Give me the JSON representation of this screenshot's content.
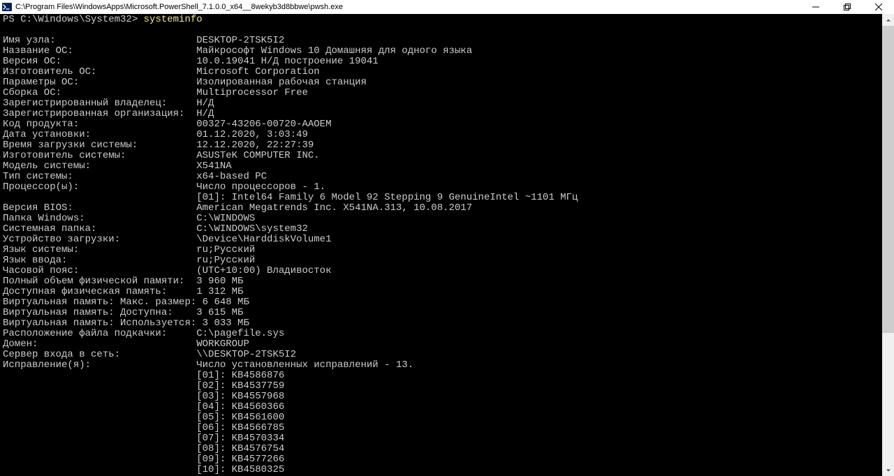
{
  "window": {
    "title": "C:\\Program Files\\WindowsApps\\Microsoft.PowerShell_7.1.0.0_x64__8wekyb3d8bbwe\\pwsh.exe"
  },
  "prompt": {
    "prefix": "PS C:\\Windows\\System32> ",
    "command": "systeminfo"
  },
  "label_width": 33,
  "rows": [
    {
      "label": "Имя узла:",
      "value": "DESKTOP-2TSK5I2"
    },
    {
      "label": "Название ОС:",
      "value": "Майкрософт Windows 10 Домашняя для одного языка"
    },
    {
      "label": "Версия ОС:",
      "value": "10.0.19041 Н/Д построение 19041"
    },
    {
      "label": "Изготовитель ОС:",
      "value": "Microsoft Corporation"
    },
    {
      "label": "Параметры ОС:",
      "value": "Изолированная рабочая станция"
    },
    {
      "label": "Сборка ОС:",
      "value": "Multiprocessor Free"
    },
    {
      "label": "Зарегистрированный владелец:",
      "value": "Н/Д"
    },
    {
      "label": "Зарегистрированная организация:",
      "value": "Н/Д"
    },
    {
      "label": "Код продукта:",
      "value": "00327-43206-00720-AAOEM"
    },
    {
      "label": "Дата установки:",
      "value": "01.12.2020, 3:03:49"
    },
    {
      "label": "Время загрузки системы:",
      "value": "12.12.2020, 22:27:39"
    },
    {
      "label": "Изготовитель системы:",
      "value": "ASUSTeK COMPUTER INC."
    },
    {
      "label": "Модель системы:",
      "value": "X541NA"
    },
    {
      "label": "Тип системы:",
      "value": "x64-based PC"
    },
    {
      "label": "Процессор(ы):",
      "value": "Число процессоров - 1."
    },
    {
      "label": "",
      "value": "[01]: Intel64 Family 6 Model 92 Stepping 9 GenuineIntel ~1101 МГц"
    },
    {
      "label": "Версия BIOS:",
      "value": "American Megatrends Inc. X541NA.313, 10.08.2017"
    },
    {
      "label": "Папка Windows:",
      "value": "C:\\WINDOWS"
    },
    {
      "label": "Системная папка:",
      "value": "C:\\WINDOWS\\system32"
    },
    {
      "label": "Устройство загрузки:",
      "value": "\\Device\\HarddiskVolume1"
    },
    {
      "label": "Язык системы:",
      "value": "ru;Русский"
    },
    {
      "label": "Язык ввода:",
      "value": "ru;Русский"
    },
    {
      "label": "Часовой пояс:",
      "value": "(UTC+10:00) Владивосток"
    },
    {
      "label": "Полный объем физической памяти:",
      "value": "3 960 МБ"
    },
    {
      "label": "Доступная физическая память:",
      "value": "1 312 МБ"
    },
    {
      "label": "Виртуальная память: Макс. размер:",
      "value": "6 648 МБ",
      "tight": true
    },
    {
      "label": "Виртуальная память: Доступна:",
      "value": "3 615 МБ"
    },
    {
      "label": "Виртуальная память: Используется:",
      "value": "3 033 МБ",
      "tight": true
    },
    {
      "label": "Расположение файла подкачки:",
      "value": "C:\\pagefile.sys"
    },
    {
      "label": "Домен:",
      "value": "WORKGROUP"
    },
    {
      "label": "Сервер входа в сеть:",
      "value": "\\\\DESKTOP-2TSK5I2"
    },
    {
      "label": "Исправление(я):",
      "value": "Число установленных исправлений - 13."
    },
    {
      "label": "",
      "value": "[01]: KB4586876"
    },
    {
      "label": "",
      "value": "[02]: KB4537759"
    },
    {
      "label": "",
      "value": "[03]: KB4557968"
    },
    {
      "label": "",
      "value": "[04]: KB4560366"
    },
    {
      "label": "",
      "value": "[05]: KB4561600"
    },
    {
      "label": "",
      "value": "[06]: KB4566785"
    },
    {
      "label": "",
      "value": "[07]: KB4570334"
    },
    {
      "label": "",
      "value": "[08]: KB4576754"
    },
    {
      "label": "",
      "value": "[09]: KB4577266"
    },
    {
      "label": "",
      "value": "[10]: KB4580325"
    }
  ]
}
